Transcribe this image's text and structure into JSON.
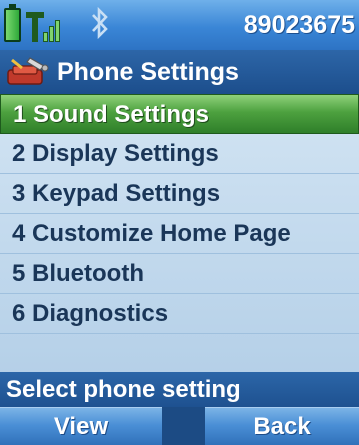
{
  "status_bar": {
    "phone_number": "89023675",
    "icons": [
      "battery-icon",
      "signal-strength-icon",
      "bluetooth-icon"
    ]
  },
  "header": {
    "icon": "phone-settings-icon",
    "title": "Phone Settings"
  },
  "menu": {
    "selected_index": 0,
    "items": [
      {
        "label": "1 Sound Settings"
      },
      {
        "label": "2 Display Settings"
      },
      {
        "label": "3 Keypad Settings"
      },
      {
        "label": "4 Customize Home Page"
      },
      {
        "label": "5 Bluetooth"
      },
      {
        "label": "6 Diagnostics"
      }
    ]
  },
  "hint": "Select phone setting",
  "softkeys": {
    "left": "View",
    "right": "Back"
  },
  "colors": {
    "selection": "#4da13f",
    "title_bar": "#1c4e8c",
    "menu_background": "#c5dbef"
  }
}
